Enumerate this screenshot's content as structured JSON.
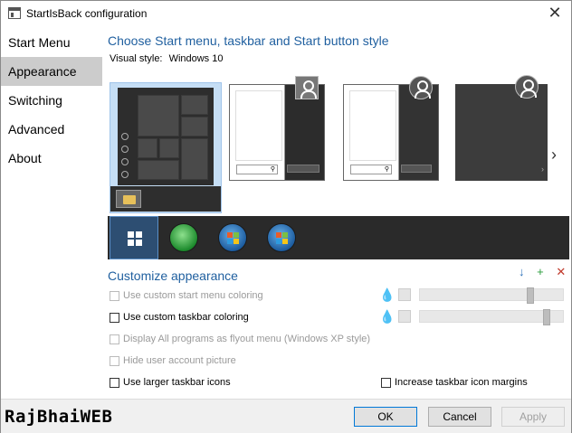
{
  "window": {
    "title": "StartIsBack configuration"
  },
  "sidebar": {
    "items": [
      {
        "label": "Start Menu",
        "active": false
      },
      {
        "label": "Appearance",
        "active": true
      },
      {
        "label": "Switching",
        "active": false
      },
      {
        "label": "Advanced",
        "active": false
      },
      {
        "label": "About",
        "active": false
      }
    ]
  },
  "main": {
    "heading": "Choose Start menu, taskbar and Start button style",
    "visual_style_label": "Visual style:",
    "visual_style_value": "Windows 10",
    "customize_heading": "Customize appearance",
    "options": {
      "custom_start_coloring": {
        "label": "Use custom start menu coloring",
        "checked": false,
        "enabled": false
      },
      "custom_taskbar_coloring": {
        "label": "Use custom taskbar coloring",
        "checked": false,
        "enabled": true
      },
      "flyout_menu": {
        "label": "Display All programs as flyout menu (Windows XP style)",
        "checked": false,
        "enabled": false
      },
      "hide_picture": {
        "label": "Hide user account picture",
        "checked": false,
        "enabled": false
      },
      "larger_icons": {
        "label": "Use larger taskbar icons",
        "checked": false,
        "enabled": true
      },
      "icon_margins": {
        "label": "Increase taskbar icon margins",
        "checked": false,
        "enabled": true
      }
    },
    "toolbar_icons": [
      "download-icon",
      "add-icon",
      "remove-icon"
    ]
  },
  "footer": {
    "watermark": "RajBhaiWEB",
    "ok": "OK",
    "cancel": "Cancel",
    "apply": "Apply"
  },
  "colors": {
    "accent": "#1f5f9f",
    "selected": "#c5def5",
    "taskbar": "#2a2a2a"
  }
}
